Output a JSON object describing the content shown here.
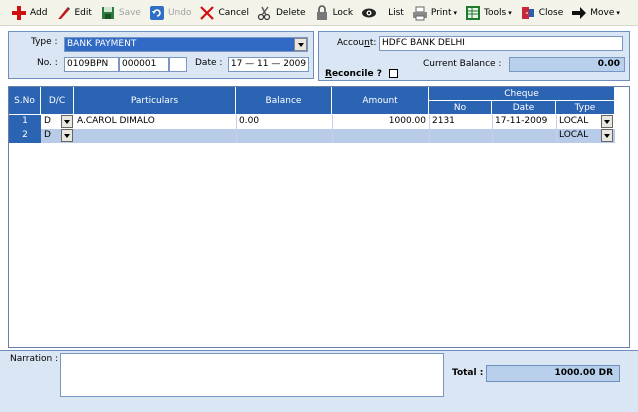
{
  "toolbar": {
    "add": "Add",
    "edit": "Edit",
    "save": "Save",
    "undo": "Undo",
    "cancel": "Cancel",
    "delete": "Delete",
    "lock": "Lock",
    "list": "List",
    "print": "Print",
    "tools": "Tools",
    "close": "Close",
    "move": "Move"
  },
  "header": {
    "type_label": "Type :",
    "type_value": "BANK PAYMENT",
    "no_label": "No. :",
    "no_prefix": "0109BPN",
    "no_number": "000001",
    "no_suffix": "",
    "date_label": "Date :",
    "date_value": "17 — 11 — 2009",
    "account_label": "Account:",
    "account_value": "HDFC BANK DELHI",
    "current_balance_label": "Current Balance :",
    "current_balance_value": "0.00",
    "reconcile_label": "Reconcile ?"
  },
  "grid": {
    "columns": {
      "sno": "S.No",
      "dc": "D/C",
      "particulars": "Particulars",
      "balance": "Balance",
      "amount": "Amount",
      "cheque": "Cheque",
      "no": "No",
      "date": "Date",
      "type": "Type"
    },
    "rows": [
      {
        "sno": "1",
        "dc": "D",
        "particulars": "A.CAROL DIMALO",
        "balance": "0.00",
        "amount": "1000.00",
        "cheque_no": "2131",
        "cheque_date": "17-11-2009",
        "cheque_type": "LOCAL"
      },
      {
        "sno": "2",
        "dc": "D",
        "particulars": "",
        "balance": "",
        "amount": "",
        "cheque_no": "",
        "cheque_date": "",
        "cheque_type": "LOCAL"
      }
    ]
  },
  "footer": {
    "narration_label": "Narration :",
    "narration_value": "",
    "total_label": "Total :",
    "total_value": "1000.00 DR"
  },
  "colors": {
    "header_blue": "#2c64b4",
    "panel_bg": "#dbe6f4",
    "row_highlight": "#b8cbe8"
  }
}
